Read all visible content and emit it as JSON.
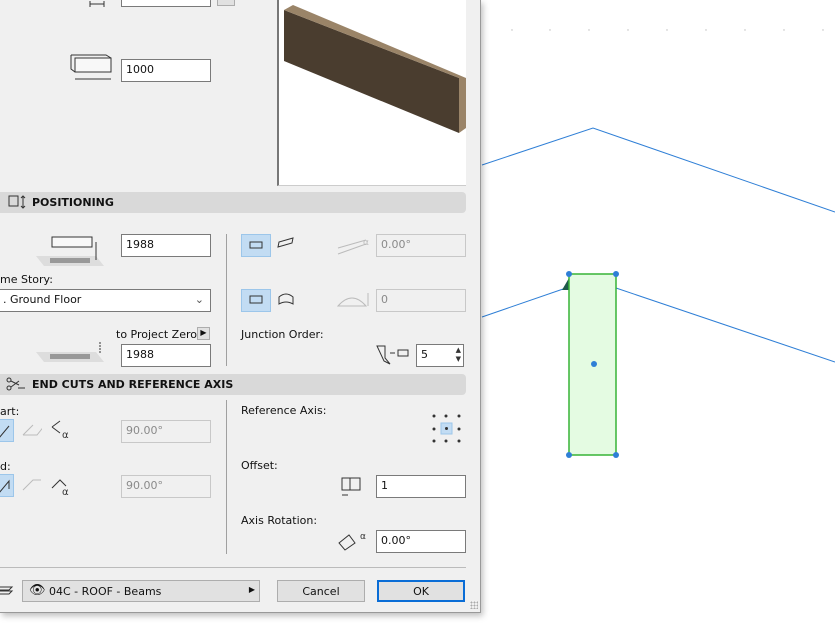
{
  "geometry": {
    "length_value": "1000"
  },
  "positioning": {
    "title": "POSITIONING",
    "offset_value": "1988",
    "home_story_label": "me Story:",
    "home_story_value": ". Ground Floor",
    "to_project_zero_label": "to Project Zero",
    "project_zero_value": "1988",
    "slant_angle": "0.00°",
    "curve_height": "0",
    "junction_order_label": "Junction Order:",
    "junction_order_value": "5"
  },
  "end_cuts": {
    "title": "END CUTS AND REFERENCE AXIS",
    "start_label": "art:",
    "start_angle": "90.00°",
    "end_label": "d:",
    "end_angle": "90.00°",
    "reference_axis_label": "Reference Axis:",
    "offset_label": "Offset:",
    "offset_value": "1",
    "axis_rotation_label": "Axis Rotation:",
    "axis_rotation_value": "0.00°"
  },
  "footer": {
    "layer": "04C - ROOF - Beams",
    "cancel": "Cancel",
    "ok": "OK"
  },
  "colors": {
    "selection_fill": "#e4fbe2",
    "selection_stroke": "#36b336",
    "line": "#2f7fd6",
    "toggle_on": "#c2dcf3",
    "ok_border": "#0a6dd6"
  }
}
